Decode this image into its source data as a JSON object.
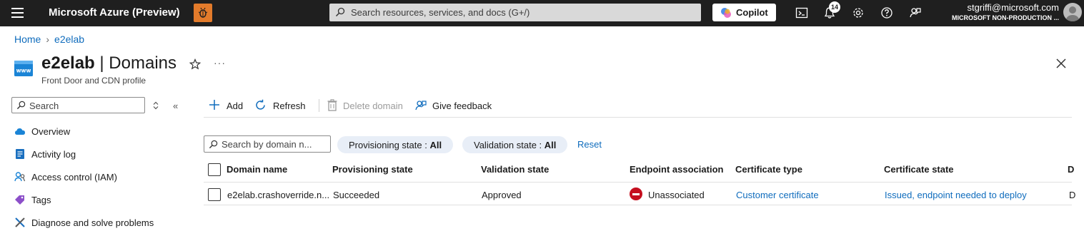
{
  "topbar": {
    "brand": "Microsoft Azure (Preview)",
    "search_placeholder": "Search resources, services, and docs (G+/)",
    "copilot_label": "Copilot",
    "notification_count": "14",
    "user_email": "stgriffi@microsoft.com",
    "user_tenant": "MICROSOFT NON-PRODUCTION ..."
  },
  "breadcrumb": {
    "items": [
      "Home",
      "e2elab"
    ]
  },
  "page": {
    "resource_name": "e2elab",
    "section": "Domains",
    "subtitle": "Front Door and CDN profile"
  },
  "sidebar": {
    "search_placeholder": "Search",
    "items": [
      {
        "label": "Overview",
        "icon": "cloud-icon"
      },
      {
        "label": "Activity log",
        "icon": "activity-log-icon"
      },
      {
        "label": "Access control (IAM)",
        "icon": "iam-icon"
      },
      {
        "label": "Tags",
        "icon": "tag-icon"
      },
      {
        "label": "Diagnose and solve problems",
        "icon": "wrench-icon"
      }
    ]
  },
  "toolbar": {
    "add_label": "Add",
    "refresh_label": "Refresh",
    "delete_label": "Delete domain",
    "feedback_label": "Give feedback"
  },
  "filters": {
    "search_placeholder": "Search by domain n...",
    "provisioning_label": "Provisioning state : ",
    "provisioning_value": "All",
    "validation_label": "Validation state : ",
    "validation_value": "All",
    "reset_label": "Reset"
  },
  "table": {
    "columns": [
      "Domain name",
      "Provisioning state",
      "Validation state",
      "Endpoint association",
      "Certificate type",
      "Certificate state",
      "D"
    ],
    "rows": [
      {
        "domain": "e2elab.crashoverride.n...",
        "provisioning": "Succeeded",
        "validation": "Approved",
        "endpoint": "Unassociated",
        "cert_type": "Customer certificate",
        "cert_state": "Issued, endpoint needed to deploy",
        "extra": "D"
      }
    ]
  },
  "colors": {
    "topbar": "#1f1f1f",
    "link": "#0f6cbd",
    "error": "#c50f1f",
    "pill": "#e8eef7"
  }
}
